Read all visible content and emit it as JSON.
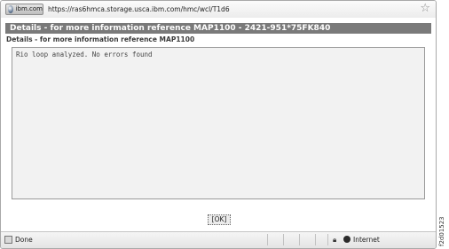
{
  "browser": {
    "site_badge": "ibm.com",
    "url": "https://ras6hmca.storage.usca.ibm.com/hmc/wcl/T1d6",
    "favorite_icon": "star-icon"
  },
  "dialog": {
    "title": "Details - for more information reference MAP1100 - 2421-951*75FK840",
    "subtitle": "Details - for more information reference MAP1100",
    "message": "Rio loop analyzed. No errors found",
    "ok_label": "[OK]"
  },
  "status_bar": {
    "status": "Done",
    "zone": "Internet"
  },
  "figure_id": "f2d01523"
}
